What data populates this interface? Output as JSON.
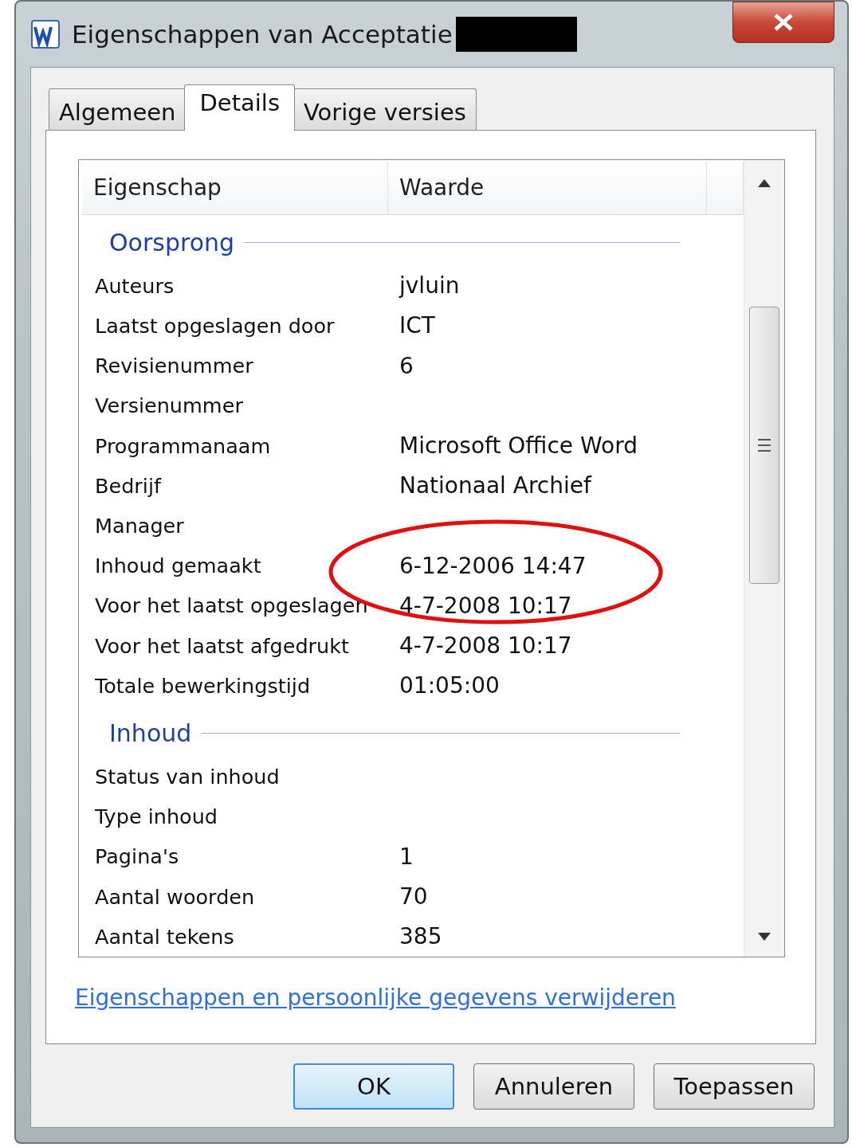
{
  "window": {
    "title": "Eigenschappen van Acceptatie"
  },
  "tabs": [
    {
      "label": "Algemeen",
      "selected": false
    },
    {
      "label": "Details",
      "selected": true
    },
    {
      "label": "Vorige versies",
      "selected": false
    }
  ],
  "table": {
    "columns": [
      "Eigenschap",
      "Waarde"
    ],
    "groups": [
      {
        "heading": "Oorsprong",
        "rows": [
          {
            "property": "Auteurs",
            "value": "jvluin"
          },
          {
            "property": "Laatst opgeslagen door",
            "value": "ICT"
          },
          {
            "property": "Revisienummer",
            "value": "6"
          },
          {
            "property": "Versienummer"
          },
          {
            "property": "Programmanaam",
            "value": "Microsoft Office Word"
          },
          {
            "property": "Bedrijf",
            "value": "Nationaal Archief"
          },
          {
            "property": "Manager"
          },
          {
            "property": "Inhoud gemaakt",
            "value": "6-12-2006 14:47"
          },
          {
            "property": "Voor het laatst opgeslagen",
            "value": "4-7-2008 10:17"
          },
          {
            "property": "Voor het laatst afgedrukt",
            "value": "4-7-2008 10:17"
          },
          {
            "property": "Totale bewerkingstijd",
            "value": "01:05:00"
          }
        ]
      },
      {
        "heading": "Inhoud",
        "rows": [
          {
            "property": "Status van inhoud"
          },
          {
            "property": "Type inhoud"
          },
          {
            "property": "Pagina's",
            "value": "1"
          },
          {
            "property": "Aantal woorden",
            "value": "70"
          },
          {
            "property": "Aantal tekens",
            "value": "385"
          }
        ]
      }
    ]
  },
  "link": "Eigenschappen en persoonlijke gegevens verwijderen",
  "buttons": [
    {
      "label": "OK",
      "default": true
    },
    {
      "label": "Annuleren",
      "default": false
    },
    {
      "label": "Toepassen",
      "default": false
    }
  ]
}
